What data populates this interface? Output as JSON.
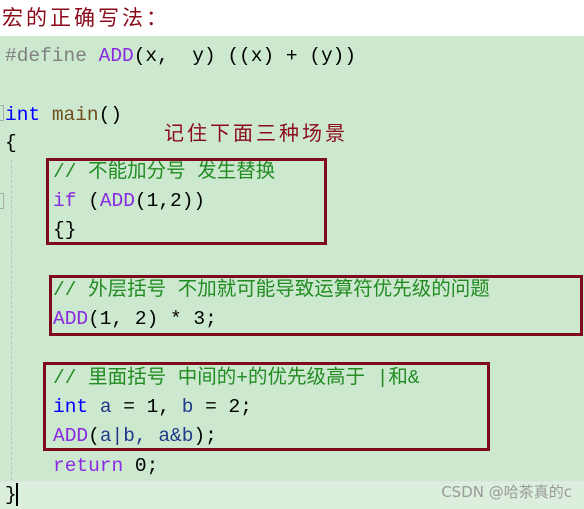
{
  "title": "宏的正确写法：",
  "annotation": "记住下面三种场景",
  "watermark": "CSDN @哈茶真的c",
  "colors": {
    "comment": "#228b22",
    "keyword": "#0000ff",
    "macro": "#8a2be2",
    "control": "#8a2be2",
    "preprocessor": "#808080",
    "text": "#000000",
    "function": "#6f4e1e",
    "identifier": "#1f3a8a",
    "box_border": "#7f0a1c"
  },
  "code": [
    {
      "indent": 0,
      "tokens": [
        {
          "t": "#define ",
          "c": "preprocessor"
        },
        {
          "t": "ADD",
          "c": "macro"
        },
        {
          "t": "(x,  y) ((x) + (y))",
          "c": "text"
        }
      ]
    },
    {
      "indent": 0,
      "tokens": []
    },
    {
      "indent": 0,
      "tokens": [
        {
          "t": "int",
          "c": "keyword"
        },
        {
          "t": " ",
          "c": "text"
        },
        {
          "t": "main",
          "c": "function"
        },
        {
          "t": "()",
          "c": "text"
        }
      ]
    },
    {
      "indent": 0,
      "tokens": [
        {
          "t": "{",
          "c": "text"
        }
      ]
    },
    {
      "indent": 4,
      "tokens": [
        {
          "t": "// 不能加分号 发生替换",
          "c": "comment"
        }
      ]
    },
    {
      "indent": 4,
      "tokens": [
        {
          "t": "if",
          "c": "control"
        },
        {
          "t": " (",
          "c": "text"
        },
        {
          "t": "ADD",
          "c": "macro"
        },
        {
          "t": "(1,2))",
          "c": "text"
        }
      ]
    },
    {
      "indent": 4,
      "tokens": [
        {
          "t": "{}",
          "c": "text"
        }
      ]
    },
    {
      "indent": 0,
      "tokens": []
    },
    {
      "indent": 4,
      "tokens": [
        {
          "t": "// 外层括号 不加就可能导致运算符优先级的问题",
          "c": "comment"
        }
      ]
    },
    {
      "indent": 4,
      "tokens": [
        {
          "t": "ADD",
          "c": "macro"
        },
        {
          "t": "(1, 2) * 3;",
          "c": "text"
        }
      ]
    },
    {
      "indent": 0,
      "tokens": []
    },
    {
      "indent": 4,
      "tokens": [
        {
          "t": "// 里面括号 中间的+的优先级高于 |和&",
          "c": "comment"
        }
      ]
    },
    {
      "indent": 4,
      "tokens": [
        {
          "t": "int",
          "c": "keyword"
        },
        {
          "t": " ",
          "c": "text"
        },
        {
          "t": "a",
          "c": "identifier"
        },
        {
          "t": " = 1, ",
          "c": "text"
        },
        {
          "t": "b",
          "c": "identifier"
        },
        {
          "t": " = 2;",
          "c": "text"
        }
      ]
    },
    {
      "indent": 4,
      "tokens": [
        {
          "t": "ADD",
          "c": "macro"
        },
        {
          "t": "(",
          "c": "text"
        },
        {
          "t": "a|b, a&b",
          "c": "identifier"
        },
        {
          "t": ");",
          "c": "text"
        }
      ]
    },
    {
      "indent": 4,
      "tokens": [
        {
          "t": "return",
          "c": "control"
        },
        {
          "t": " 0;",
          "c": "text"
        }
      ]
    },
    {
      "indent": 0,
      "tokens": [
        {
          "t": "}",
          "c": "text"
        }
      ]
    }
  ]
}
